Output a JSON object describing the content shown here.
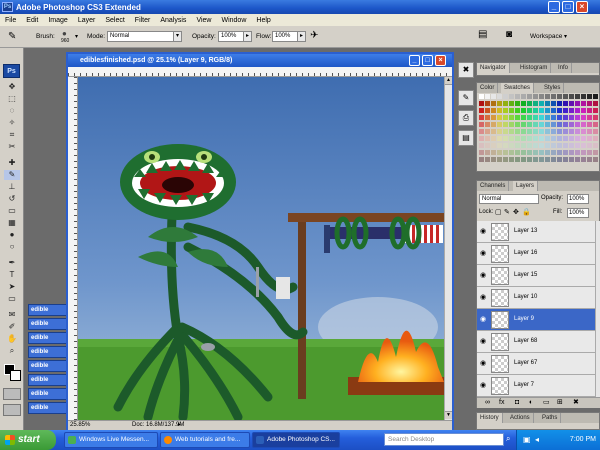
{
  "app": {
    "title": "Adobe Photoshop CS3 Extended"
  },
  "menu": [
    "File",
    "Edit",
    "Image",
    "Layer",
    "Select",
    "Filter",
    "Analysis",
    "View",
    "Window",
    "Help"
  ],
  "options": {
    "brush_label": "Brush:",
    "brush_size": "960",
    "mode_label": "Mode:",
    "mode_value": "Normal",
    "opacity_label": "Opacity:",
    "opacity_value": "100%",
    "flow_label": "Flow:",
    "flow_value": "100%",
    "workspace_label": "Workspace"
  },
  "document": {
    "title": "ediblesfinished.psd @ 25.1% (Layer 9, RGB/8)",
    "zoom": "25.85%",
    "doc_info": "Doc: 16.8M/137.9M"
  },
  "minimized_docs": [
    "edible",
    "edible",
    "edible",
    "edible",
    "edible",
    "edible",
    "edible",
    "edible"
  ],
  "navigator_tabs": [
    "Navigator",
    "Histogram",
    "Info"
  ],
  "color_tabs": [
    "Color",
    "Swatches",
    "Styles"
  ],
  "layers_tabs": [
    "Channels",
    "Layers"
  ],
  "layers": {
    "blend_mode": "Normal",
    "opacity_label": "Opacity:",
    "opacity_value": "100%",
    "lock_label": "Lock:",
    "fill_label": "Fill:",
    "fill_value": "100%",
    "items": [
      {
        "name": "Layer 13"
      },
      {
        "name": "Layer 16"
      },
      {
        "name": "Layer 15"
      },
      {
        "name": "Layer 10"
      },
      {
        "name": "Layer 9"
      },
      {
        "name": "Layer 68"
      },
      {
        "name": "Layer 67"
      },
      {
        "name": "Layer 7"
      }
    ],
    "active_index": 4
  },
  "history_tabs": [
    "History",
    "Actions",
    "Paths"
  ],
  "taskbar": {
    "start_label": "start",
    "items": [
      {
        "label": "Windows Live Messen..."
      },
      {
        "label": "Web tutorials and fre..."
      },
      {
        "label": "Adobe Photoshop CS..."
      }
    ],
    "search_placeholder": "Search Desktop",
    "time": "7:00 PM"
  },
  "colors": {
    "title_bar": "#1c56c8",
    "accent": "#3b67c7",
    "menu_bg": "#ece9d8",
    "panel_bg": "#d4d0c8"
  }
}
